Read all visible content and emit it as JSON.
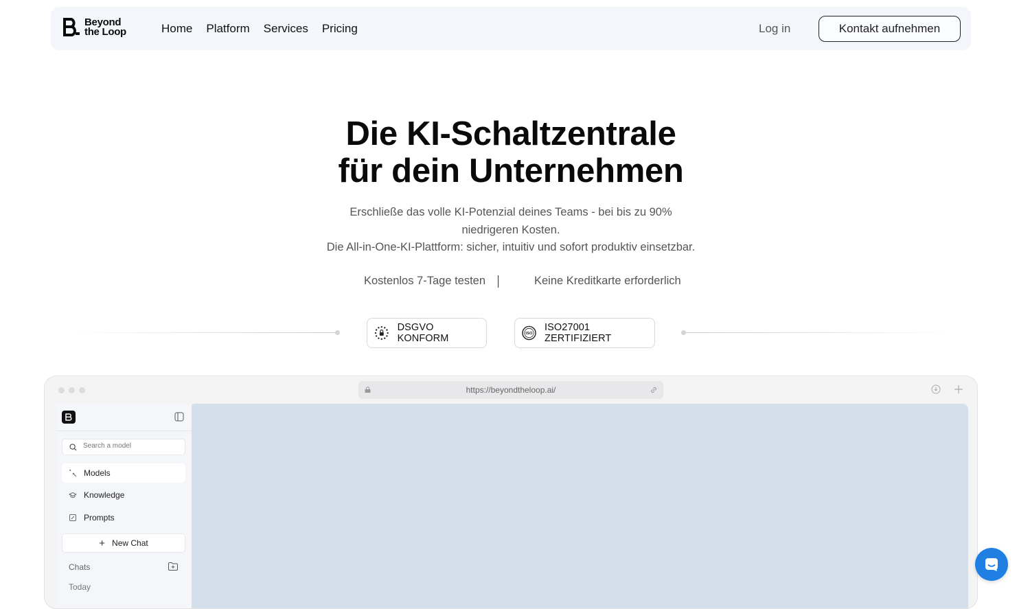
{
  "nav": {
    "logo_line1": "Beyond",
    "logo_line2": "the Loop",
    "links": [
      "Home",
      "Platform",
      "Services",
      "Pricing"
    ],
    "login": "Log in",
    "contact": "Kontakt aufnehmen"
  },
  "hero": {
    "title_line1": "Die KI-Schaltzentrale",
    "title_line2": "für dein Unternehmen",
    "sub_line1": "Erschließe das volle KI-Potenzial deines Teams - bei bis zu 90%",
    "sub_line2": "niedrigeren Kosten.",
    "sub_line3": "Die All-in-One-KI-Plattform: sicher, intuitiv und sofort produktiv einsetzbar.",
    "trial": "Kostenlos 7-Tage testen",
    "no_card": "Keine Kreditkarte erforderlich"
  },
  "badges": {
    "dsgvo": "DSGVO KONFORM",
    "iso": "ISO27001 ZERTIFIZIERT",
    "iso_seal_text": "ISO"
  },
  "browser": {
    "url": "https://beyondtheloop.ai/",
    "search_placeholder": "Search a model",
    "menu": [
      "Models",
      "Knowledge",
      "Prompts"
    ],
    "new_chat": "New Chat",
    "chats": "Chats",
    "today": "Today"
  },
  "colors": {
    "accent": "#1f7fe3",
    "nav_bg": "#f3f6fa",
    "content_bg": "#d3dfea"
  }
}
